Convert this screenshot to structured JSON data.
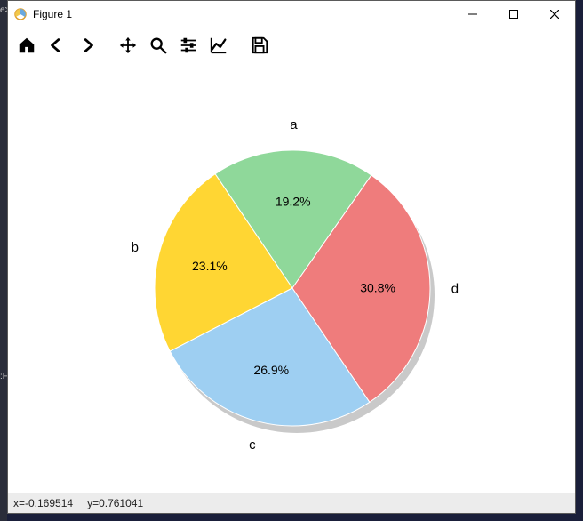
{
  "window": {
    "title": "Figure 1",
    "controls": {
      "minimize": "—",
      "maximize": "☐",
      "close": "✕"
    }
  },
  "toolbar": {
    "home": "home-icon",
    "back": "arrow-left-icon",
    "fwd": "arrow-right-icon",
    "pan": "move-icon",
    "zoom": "zoom-icon",
    "config": "sliders-icon",
    "edit": "axes-edit-icon",
    "save": "save-icon"
  },
  "status": {
    "x_label": "x=-0.169514",
    "y_label": "y=0.761041"
  },
  "left_strip": {
    "top": "e>",
    "mid": ":F"
  },
  "chart_data": {
    "type": "pie",
    "title": "",
    "slices": [
      {
        "label": "a",
        "value": 19.2,
        "pct_text": "19.2%",
        "color": "#8fd89a"
      },
      {
        "label": "b",
        "value": 23.1,
        "pct_text": "23.1%",
        "color": "#ffd633"
      },
      {
        "label": "c",
        "value": 26.9,
        "pct_text": "26.9%",
        "color": "#9ecff2"
      },
      {
        "label": "d",
        "value": 30.8,
        "pct_text": "30.8%",
        "color": "#ef7c7c"
      }
    ],
    "start_angle_deg": 55,
    "direction": "counterclockwise",
    "shadow": true
  }
}
